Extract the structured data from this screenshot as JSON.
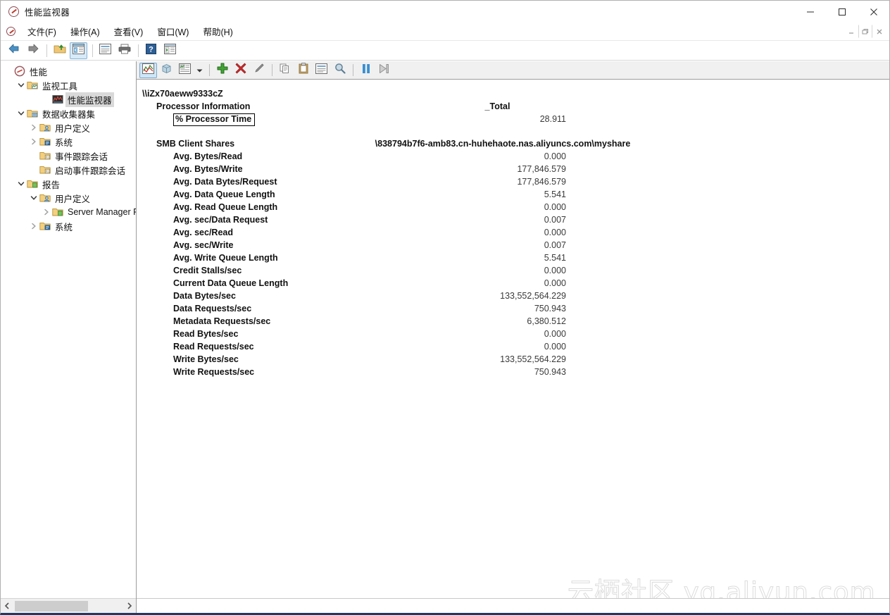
{
  "window": {
    "title": "性能监视器",
    "app_icon": "performance-monitor-icon",
    "controls": {
      "minimize": "minimize-icon",
      "maximize": "maximize-icon",
      "close": "close-icon"
    },
    "mdi_controls": {
      "minimize": "mdi-minimize-icon",
      "restore": "mdi-restore-icon",
      "close": "mdi-close-icon"
    }
  },
  "menubar": {
    "items": [
      {
        "label": "文件(F)"
      },
      {
        "label": "操作(A)"
      },
      {
        "label": "查看(V)"
      },
      {
        "label": "窗口(W)"
      },
      {
        "label": "帮助(H)"
      }
    ]
  },
  "toolbar": {
    "buttons": [
      {
        "name": "back-button",
        "icon": "arrow-left-icon",
        "selected": false
      },
      {
        "name": "forward-button",
        "icon": "arrow-right-icon",
        "selected": false
      },
      {
        "name": "up-one-level-button",
        "icon": "folder-up-icon",
        "selected": false
      },
      {
        "name": "show-hide-console-tree-button",
        "icon": "console-tree-icon",
        "selected": true
      },
      {
        "name": "properties-button",
        "icon": "properties-icon",
        "selected": false
      },
      {
        "name": "print-button",
        "icon": "printer-icon",
        "selected": false
      },
      {
        "name": "help-button",
        "icon": "help-question-icon",
        "selected": false
      },
      {
        "name": "new-window-button",
        "icon": "new-window-icon",
        "selected": false
      }
    ]
  },
  "perf_toolbar": {
    "buttons": [
      {
        "name": "view-graph-button",
        "icon": "line-graph-icon",
        "selected": true
      },
      {
        "name": "view-histogram-button",
        "icon": "histogram-cube-icon",
        "selected": false
      },
      {
        "name": "view-report-button",
        "icon": "report-view-icon",
        "selected": false
      },
      {
        "name": "view-dropdown-button",
        "icon": "chevron-down-icon",
        "selected": false
      },
      {
        "name": "add-counters-button",
        "icon": "plus-green-icon",
        "selected": false
      },
      {
        "name": "delete-counter-button",
        "icon": "cross-red-icon",
        "selected": false
      },
      {
        "name": "highlight-button",
        "icon": "pencil-highlight-icon",
        "selected": false
      },
      {
        "name": "copy-properties-button",
        "icon": "copy-icon",
        "selected": false
      },
      {
        "name": "paste-counter-list-button",
        "icon": "clipboard-paste-icon",
        "selected": false
      },
      {
        "name": "properties-button",
        "icon": "properties-icon",
        "selected": false
      },
      {
        "name": "zoom-button",
        "icon": "magnifier-icon",
        "selected": false
      },
      {
        "name": "freeze-display-button",
        "icon": "pause-icon",
        "selected": false
      },
      {
        "name": "update-data-button",
        "icon": "step-forward-icon",
        "selected": false
      }
    ]
  },
  "tree": {
    "nodes": [
      {
        "label": "性能",
        "indent": 0,
        "chevron": "none",
        "icon": "performance-root-icon",
        "selected": false
      },
      {
        "label": "监视工具",
        "indent": 1,
        "chevron": "expanded",
        "icon": "folder-monitor-icon",
        "selected": false
      },
      {
        "label": "性能监视器",
        "indent": 3,
        "chevron": "none",
        "icon": "perfmon-graph-icon",
        "selected": true
      },
      {
        "label": "数据收集器集",
        "indent": 1,
        "chevron": "expanded",
        "icon": "folder-collector-icon",
        "selected": false
      },
      {
        "label": "用户定义",
        "indent": 2,
        "chevron": "collapsed",
        "icon": "folder-user-icon",
        "selected": false
      },
      {
        "label": "系统",
        "indent": 2,
        "chevron": "collapsed",
        "icon": "folder-system-icon",
        "selected": false
      },
      {
        "label": "事件跟踪会话",
        "indent": 2,
        "chevron": "none",
        "icon": "folder-event-icon",
        "selected": false
      },
      {
        "label": "启动事件跟踪会话",
        "indent": 2,
        "chevron": "none",
        "icon": "folder-event-icon",
        "selected": false
      },
      {
        "label": "报告",
        "indent": 1,
        "chevron": "expanded",
        "icon": "folder-report-icon",
        "selected": false
      },
      {
        "label": "用户定义",
        "indent": 2,
        "chevron": "expanded",
        "icon": "folder-user-icon",
        "selected": false
      },
      {
        "label": "Server Manager P",
        "indent": 3,
        "chevron": "collapsed",
        "icon": "folder-report-icon",
        "selected": false
      },
      {
        "label": "系统",
        "indent": 2,
        "chevron": "collapsed",
        "icon": "folder-system-icon",
        "selected": false
      }
    ],
    "hscroll": {
      "left_arrow": "chevron-left-icon",
      "right_arrow": "chevron-right-icon"
    }
  },
  "report": {
    "machine": "\\\\iZx70aeww9333cZ",
    "sections": [
      {
        "object": "Processor Information",
        "instance": "_Total",
        "instance_wide": false,
        "counters": [
          {
            "name": "% Processor Time",
            "value": "28.911",
            "focused": true
          }
        ]
      },
      {
        "object": "SMB Client Shares",
        "instance": "\\838794b7f6-amb83.cn-huhehaote.nas.aliyuncs.com\\myshare",
        "instance_wide": true,
        "counters": [
          {
            "name": "Avg. Bytes/Read",
            "value": "0.000",
            "focused": false
          },
          {
            "name": "Avg. Bytes/Write",
            "value": "177,846.579",
            "focused": false
          },
          {
            "name": "Avg. Data Bytes/Request",
            "value": "177,846.579",
            "focused": false
          },
          {
            "name": "Avg. Data Queue Length",
            "value": "5.541",
            "focused": false
          },
          {
            "name": "Avg. Read Queue Length",
            "value": "0.000",
            "focused": false
          },
          {
            "name": "Avg. sec/Data Request",
            "value": "0.007",
            "focused": false
          },
          {
            "name": "Avg. sec/Read",
            "value": "0.000",
            "focused": false
          },
          {
            "name": "Avg. sec/Write",
            "value": "0.007",
            "focused": false
          },
          {
            "name": "Avg. Write Queue Length",
            "value": "5.541",
            "focused": false
          },
          {
            "name": "Credit Stalls/sec",
            "value": "0.000",
            "focused": false
          },
          {
            "name": "Current Data Queue Length",
            "value": "0.000",
            "focused": false
          },
          {
            "name": "Data Bytes/sec",
            "value": "133,552,564.229",
            "focused": false
          },
          {
            "name": "Data Requests/sec",
            "value": "750.943",
            "focused": false
          },
          {
            "name": "Metadata Requests/sec",
            "value": "6,380.512",
            "focused": false
          },
          {
            "name": "Read Bytes/sec",
            "value": "0.000",
            "focused": false
          },
          {
            "name": "Read Requests/sec",
            "value": "0.000",
            "focused": false
          },
          {
            "name": "Write Bytes/sec",
            "value": "133,552,564.229",
            "focused": false
          },
          {
            "name": "Write Requests/sec",
            "value": "750.943",
            "focused": false
          }
        ]
      }
    ]
  },
  "watermark": {
    "text": "云栖社区 yq.aliyun.com"
  },
  "colors": {
    "accent_selection": "#d6eaf8",
    "tree_selection": "#d9d9d9",
    "toolbar_bg": "#f0f0f0",
    "bottom_border": "#1f3864",
    "add_icon": "#41a334",
    "delete_icon": "#cc2b2b",
    "pause_icon": "#3a8fd0"
  }
}
